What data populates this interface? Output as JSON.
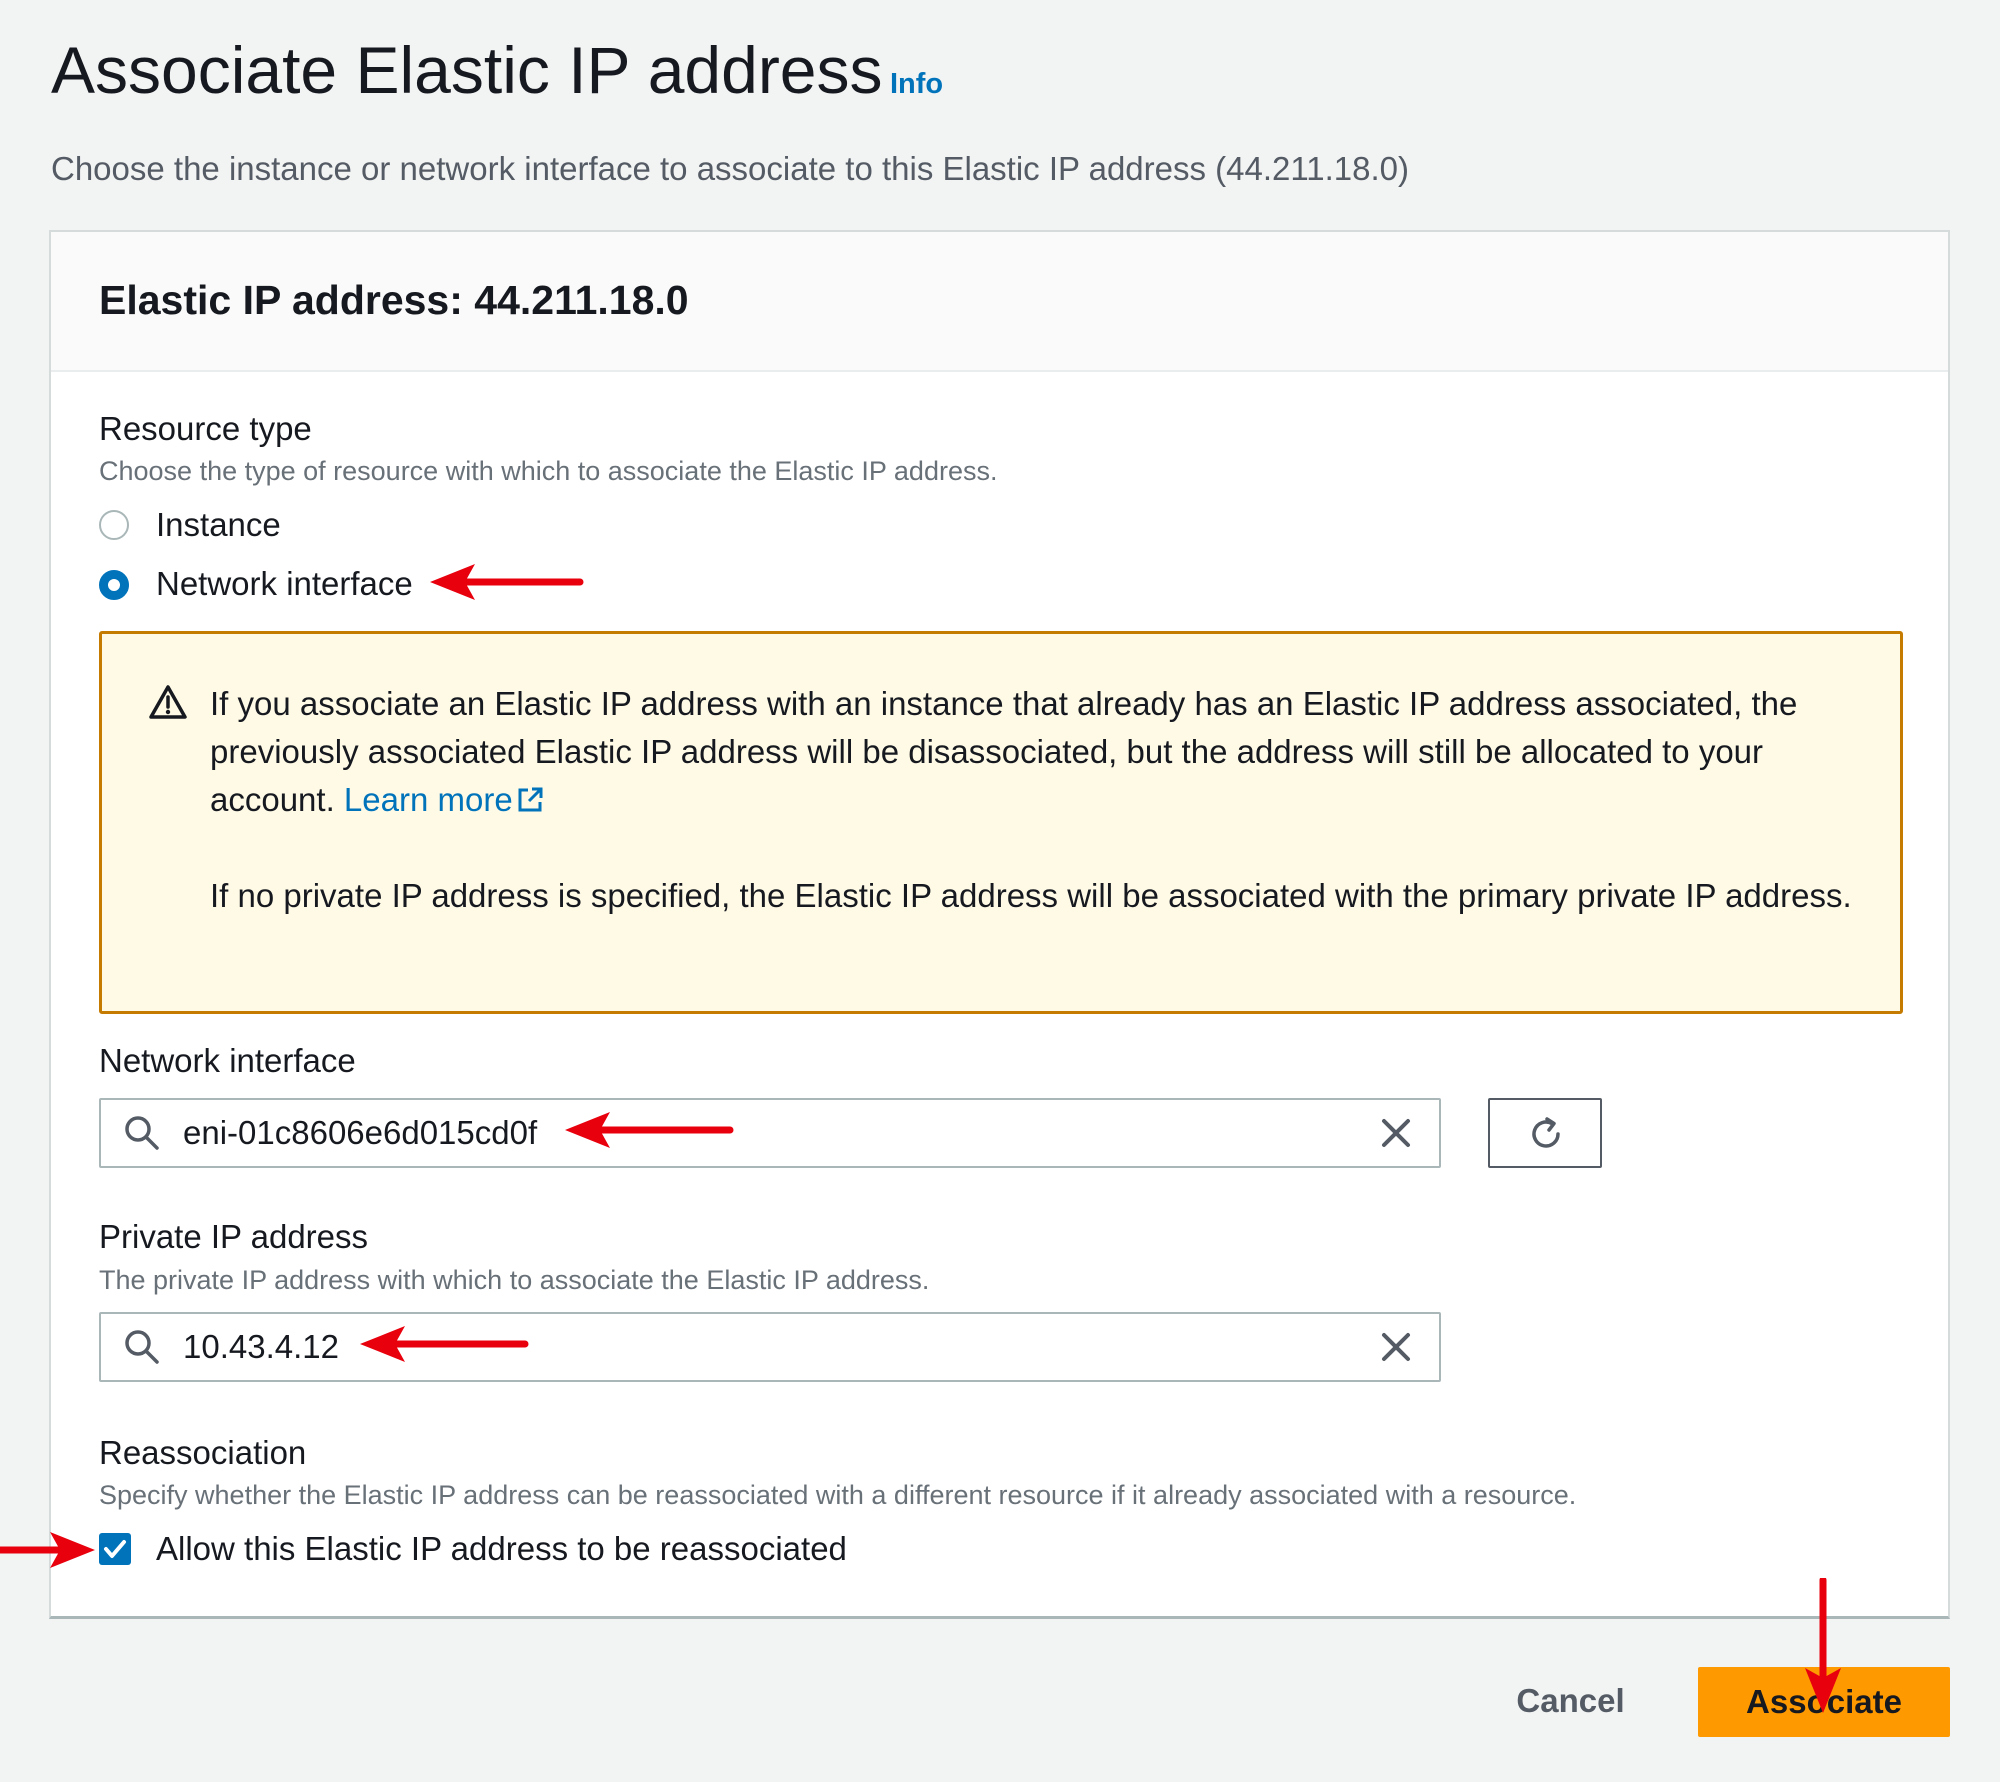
{
  "header": {
    "title": "Associate Elastic IP address",
    "info_label": "Info",
    "description": "Choose the instance or network interface to associate to this Elastic IP address (44.211.18.0)"
  },
  "card": {
    "title": "Elastic IP address: 44.211.18.0"
  },
  "resource_type": {
    "label": "Resource type",
    "description": "Choose the type of resource with which to associate the Elastic IP address.",
    "options": [
      {
        "label": "Instance",
        "selected": false
      },
      {
        "label": "Network interface",
        "selected": true
      }
    ]
  },
  "alert": {
    "line1": "If you associate an Elastic IP address with an instance that already has an Elastic IP address associated, the previously associated Elastic IP address will be disassociated, but the address will still be allocated to your account. ",
    "learn_more": "Learn more",
    "line2": "If no private IP address is specified, the Elastic IP address will be associated with the primary private IP address."
  },
  "network_interface": {
    "label": "Network interface",
    "value": "eni-01c8606e6d015cd0f"
  },
  "private_ip": {
    "label": "Private IP address",
    "description": "The private IP address with which to associate the Elastic IP address.",
    "value": "10.43.4.12"
  },
  "reassociation": {
    "label": "Reassociation",
    "description": "Specify whether the Elastic IP address can be reassociated with a different resource if it already associated with a resource.",
    "checkbox_label": "Allow this Elastic IP address to be reassociated",
    "checked": true
  },
  "footer": {
    "cancel_label": "Cancel",
    "associate_label": "Associate"
  },
  "colors": {
    "primary_button": "#ff9900",
    "link": "#0073bb",
    "alert_border": "#c57a00",
    "alert_background": "#fffae6",
    "annotation_arrow": "#e8000d"
  },
  "icons": [
    "info-link",
    "warning-icon",
    "external-link-icon",
    "search-icon",
    "clear-icon",
    "refresh-icon",
    "checkmark-icon",
    "annotation-arrow"
  ]
}
